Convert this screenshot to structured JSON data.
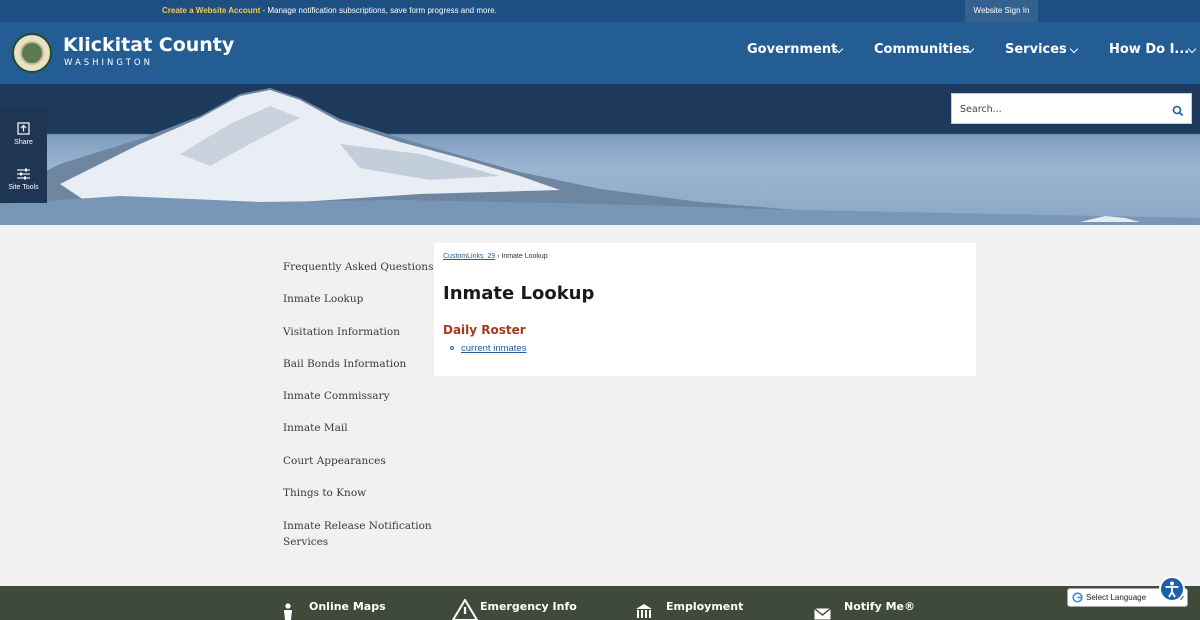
{
  "topbar": {
    "create_account_link": "Create a Website Account",
    "create_account_rest": " - Manage notification subscriptions, save form progress and more.",
    "sign_in": "Website Sign In"
  },
  "header": {
    "name": "Klickitat County",
    "sub": "WASHINGTON",
    "nav": [
      "Government",
      "Communities",
      "Services",
      "How Do I..."
    ]
  },
  "search": {
    "placeholder": "Search..."
  },
  "tools": {
    "share": "Share",
    "site_tools": "Site Tools"
  },
  "sidenav": [
    "Frequently Asked Questions",
    "Inmate Lookup",
    "Visitation Information",
    "Bail Bonds Information",
    "Inmate Commissary",
    "Inmate Mail",
    "Court Appearances",
    "Things to Know",
    "Inmate Release Notification",
    "Services"
  ],
  "content": {
    "breadcrumb_link": "CustomLinks_29",
    "breadcrumb_sep": " › ",
    "breadcrumb_current": "Inmate Lookup",
    "title": "Inmate Lookup",
    "subtitle": "Daily Roster",
    "link": "current inmates"
  },
  "footer": [
    "Online Maps",
    "Emergency Info",
    "Employment",
    "Notify Me®"
  ],
  "translate": {
    "label": "Select Language"
  },
  "colors": {
    "header": "#245d94",
    "topbar": "#1e4f82",
    "footer": "#3f4a3a",
    "accent": "#a33b22"
  }
}
